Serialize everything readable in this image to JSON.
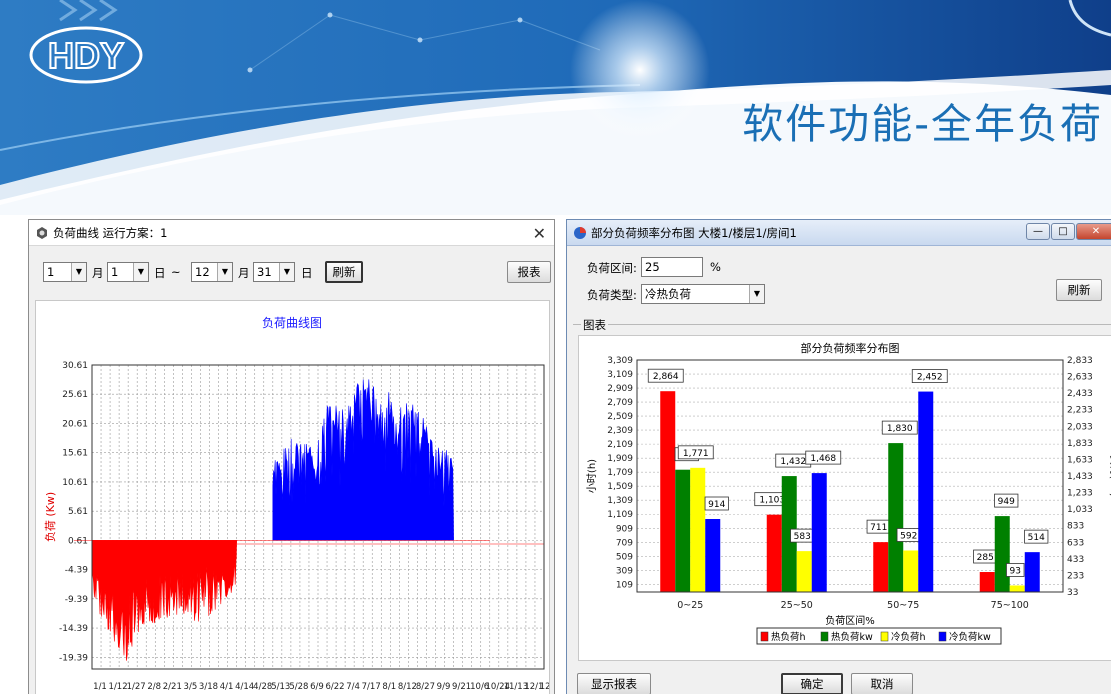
{
  "banner": {
    "logo_text": "HDY",
    "title": "软件功能-全年负荷"
  },
  "left_window": {
    "title": "负荷曲线  运行方案：1",
    "controls": {
      "start_month": "1",
      "month_label_1": "月",
      "start_day": "1",
      "day_label_1": "日",
      "tilde": "~",
      "end_month": "12",
      "month_label_2": "月",
      "end_day": "31",
      "day_label_2": "日",
      "refresh": "刷新",
      "report": "报表"
    },
    "chart_data": {
      "type": "area",
      "title": "负荷曲线图",
      "ylabel": "负荷 (Kw)",
      "xlabel": "",
      "ylim": [
        -21.39,
        30.61
      ],
      "yticks": [
        30.61,
        25.61,
        20.61,
        15.61,
        10.61,
        5.61,
        0.61,
        -4.39,
        -9.39,
        -14.39,
        -19.39
      ],
      "x_tick_labels": [
        "1/1",
        "1/12",
        "1/27",
        "2/8",
        "2/21",
        "3/5",
        "3/18",
        "4/1",
        "4/14",
        "4/28",
        "5/13",
        "5/28",
        "6/9",
        "6/22",
        "7/4",
        "7/17",
        "8/1",
        "8/12",
        "8/27",
        "9/9",
        "9/21",
        "10/6",
        "10/24",
        "11/13",
        "12/1",
        "12/17"
      ],
      "grid": true,
      "series": [
        {
          "color": "#ff0000",
          "x_range": [
            "1/1",
            "4/14"
          ],
          "envelope_x": [
            "1/1",
            "1/12",
            "1/27",
            "2/8",
            "2/21",
            "3/5",
            "3/18",
            "4/1",
            "4/14"
          ],
          "envelope_y": [
            -9,
            -16,
            -20.5,
            -14,
            -13.5,
            -12,
            -14,
            -11,
            -8
          ],
          "baseline_y": [
            -3.5,
            -5.5,
            -8.5,
            -5,
            -4.5,
            -4,
            -4,
            -3.5,
            -2.5
          ]
        },
        {
          "color": "#0000ff",
          "x_range": [
            "5/13",
            "9/21"
          ],
          "envelope_x": [
            "5/13",
            "5/28",
            "6/9",
            "6/22",
            "7/4",
            "7/17",
            "8/1",
            "8/12",
            "8/27",
            "9/9",
            "9/21"
          ],
          "envelope_y": [
            14,
            18,
            17,
            25,
            24,
            29.5,
            26.5,
            25.5,
            24,
            17,
            15.5
          ],
          "baseline_y": [
            5.5,
            6.5,
            7,
            9,
            10,
            13,
            12,
            10,
            9.5,
            7,
            5.5
          ]
        },
        {
          "color": "#ff0000",
          "x_range": [
            "10/24",
            "12/31"
          ],
          "envelope_x": [
            "10/24",
            "11/13",
            "12/1",
            "12/17",
            "12/31"
          ],
          "envelope_y": [
            -10,
            -13,
            -16,
            -17.5,
            -14
          ],
          "baseline_y": [
            -3,
            -4.5,
            -6,
            -7,
            -5.5
          ]
        }
      ]
    }
  },
  "right_window": {
    "title": "部分负荷频率分布图  大楼1/楼层1/房间1",
    "caption_buttons": [
      "—",
      "□",
      "✕"
    ],
    "load_interval_label": "负荷区间:",
    "load_interval_value": "25",
    "percent_sign": "%",
    "load_type_label": "负荷类型:",
    "load_type_value": "冷热负荷",
    "refresh": "刷新",
    "group_label": "图表",
    "show_report": "显示报表",
    "ok": "确定",
    "cancel": "取消",
    "chart_data": {
      "type": "bar",
      "title": "部分负荷频率分布图",
      "xlabel": "负荷区间%",
      "ylabel": "小时(h)",
      "y2label": "负荷(kw)",
      "categories": [
        "0~25",
        "25~50",
        "50~75",
        "75~100"
      ],
      "ylim": [
        0,
        3309
      ],
      "y2lim": [
        33,
        2833
      ],
      "yticks": [
        109,
        309,
        509,
        709,
        909,
        1109,
        1309,
        1509,
        1709,
        1909,
        2109,
        2309,
        2509,
        2709,
        2909,
        3109,
        3309
      ],
      "y2ticks": [
        33,
        233,
        433,
        633,
        833,
        1033,
        1233,
        1433,
        1633,
        1833,
        2033,
        2233,
        2433,
        2633,
        2833
      ],
      "legend_position": "bottom",
      "series": [
        {
          "name": "热负荷h",
          "color": "#ff0000",
          "axis": "left",
          "values": [
            2864,
            1103,
            711,
            285
          ],
          "labels": [
            "2,864",
            "1,103",
            "711",
            "285"
          ]
        },
        {
          "name": "热负荷kw",
          "color": "#008000",
          "axis": "right",
          "values": [
            1509,
            1432,
            1830,
            949
          ],
          "labels": [
            "1,5",
            "1,432",
            "1,830",
            "949"
          ]
        },
        {
          "name": "冷负荷h",
          "color": "#ffff00",
          "axis": "left",
          "values": [
            1771,
            583,
            592,
            93
          ],
          "labels": [
            "1,771",
            "583",
            "592",
            "93"
          ]
        },
        {
          "name": "冷负荷kw",
          "color": "#0000ff",
          "axis": "right",
          "values": [
            914,
            1468,
            2452,
            514
          ],
          "labels": [
            "914",
            "1,468",
            "2,452",
            "514"
          ]
        }
      ]
    }
  }
}
